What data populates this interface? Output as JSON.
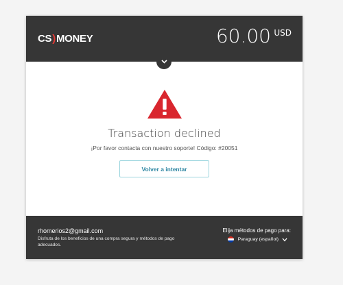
{
  "header": {
    "logo_left": "CS",
    "logo_mark": ")",
    "logo_right": "MONEY",
    "amount": "60.00",
    "currency": "USD"
  },
  "main": {
    "title": "Transaction declined",
    "message": "¡Por favor contacta con nuestro soporte! Código: #20051",
    "retry_label": "Volver a intentar"
  },
  "footer": {
    "email": "rhomerios2@gmail.com",
    "description": "Disfruta de los beneficios de una compra segura y métodos de pago adecuados.",
    "payment_label": "Elija métodos de pago para:",
    "country": "Paraguay (español)"
  },
  "colors": {
    "header_bg": "#363636",
    "warning_red": "#d9262e",
    "retry_text": "#2f87a3",
    "retry_border": "#9cd5de"
  },
  "icons": [
    "chevron-down-icon",
    "warning-icon",
    "flag-icon",
    "chevron-down-icon"
  ]
}
